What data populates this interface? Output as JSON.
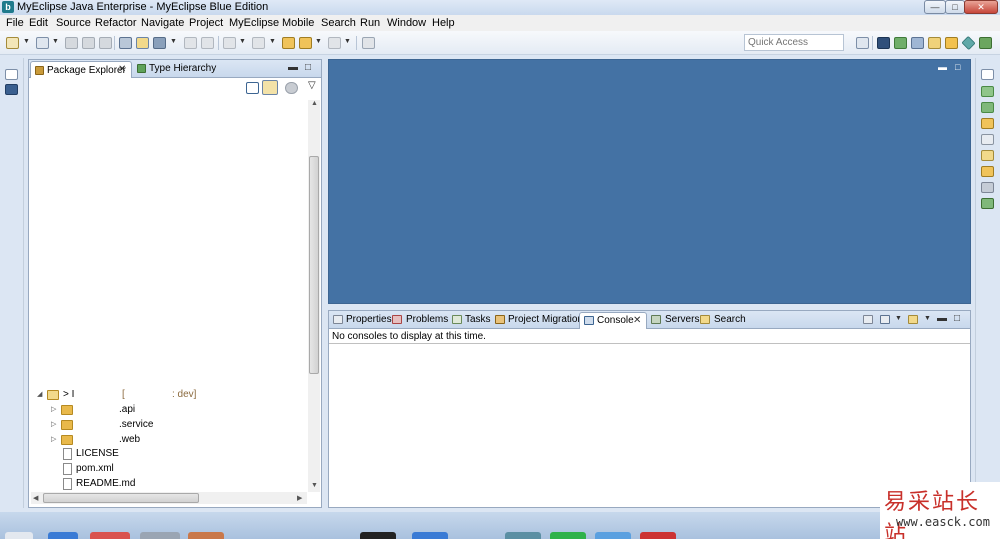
{
  "window": {
    "title": "MyEclipse Java Enterprise - MyEclipse Blue Edition",
    "app_icon_glyph": "b",
    "controls": {
      "minimize": "—",
      "maximize": "□",
      "close": "✕"
    }
  },
  "menu": [
    "File",
    "Edit",
    "Source",
    "Refactor",
    "Navigate",
    "Project",
    "MyEclipse",
    "Mobile",
    "Search",
    "Run",
    "Window",
    "Help"
  ],
  "toolbar": {
    "quick_access_placeholder": "Quick Access",
    "dropdown_glyph": "▼"
  },
  "package_explorer": {
    "tab_label": "Package Explorer",
    "tab_close": "✕",
    "other_tab_label": "Type Hierarchy",
    "minimize": "▬",
    "maximize": "□",
    "menu_glyph": "▽",
    "tree": {
      "root_prefix": "> I",
      "root_branch_open": "[",
      "root_branch": ": dev]",
      "items": [
        {
          "label": ".api",
          "type": "folder"
        },
        {
          "label": ".service",
          "type": "folder"
        },
        {
          "label": ".web",
          "type": "folder"
        },
        {
          "label": "LICENSE",
          "type": "file"
        },
        {
          "label": "pom.xml",
          "type": "file"
        },
        {
          "label": "README.md",
          "type": "file"
        }
      ]
    },
    "scroll": {
      "up": "▲",
      "down": "▼",
      "left": "◀",
      "right": "▶"
    }
  },
  "editor": {
    "minimize": "▬",
    "maximize": "□"
  },
  "bottom_panel": {
    "tabs": [
      "Properties",
      "Problems",
      "Tasks",
      "Project Migration",
      "Console",
      "Servers",
      "Search"
    ],
    "active_tab": "Console",
    "tab_close": "✕",
    "console_message": "No consoles to display at this time.",
    "minimize": "▬",
    "maximize": "□"
  },
  "watermark": {
    "chinese": "易采站长站",
    "url": "www.easck.com"
  },
  "colors": {
    "editor_background": "#4472a4",
    "folder": "#e9b94a",
    "watermark_red": "#c8302a"
  }
}
